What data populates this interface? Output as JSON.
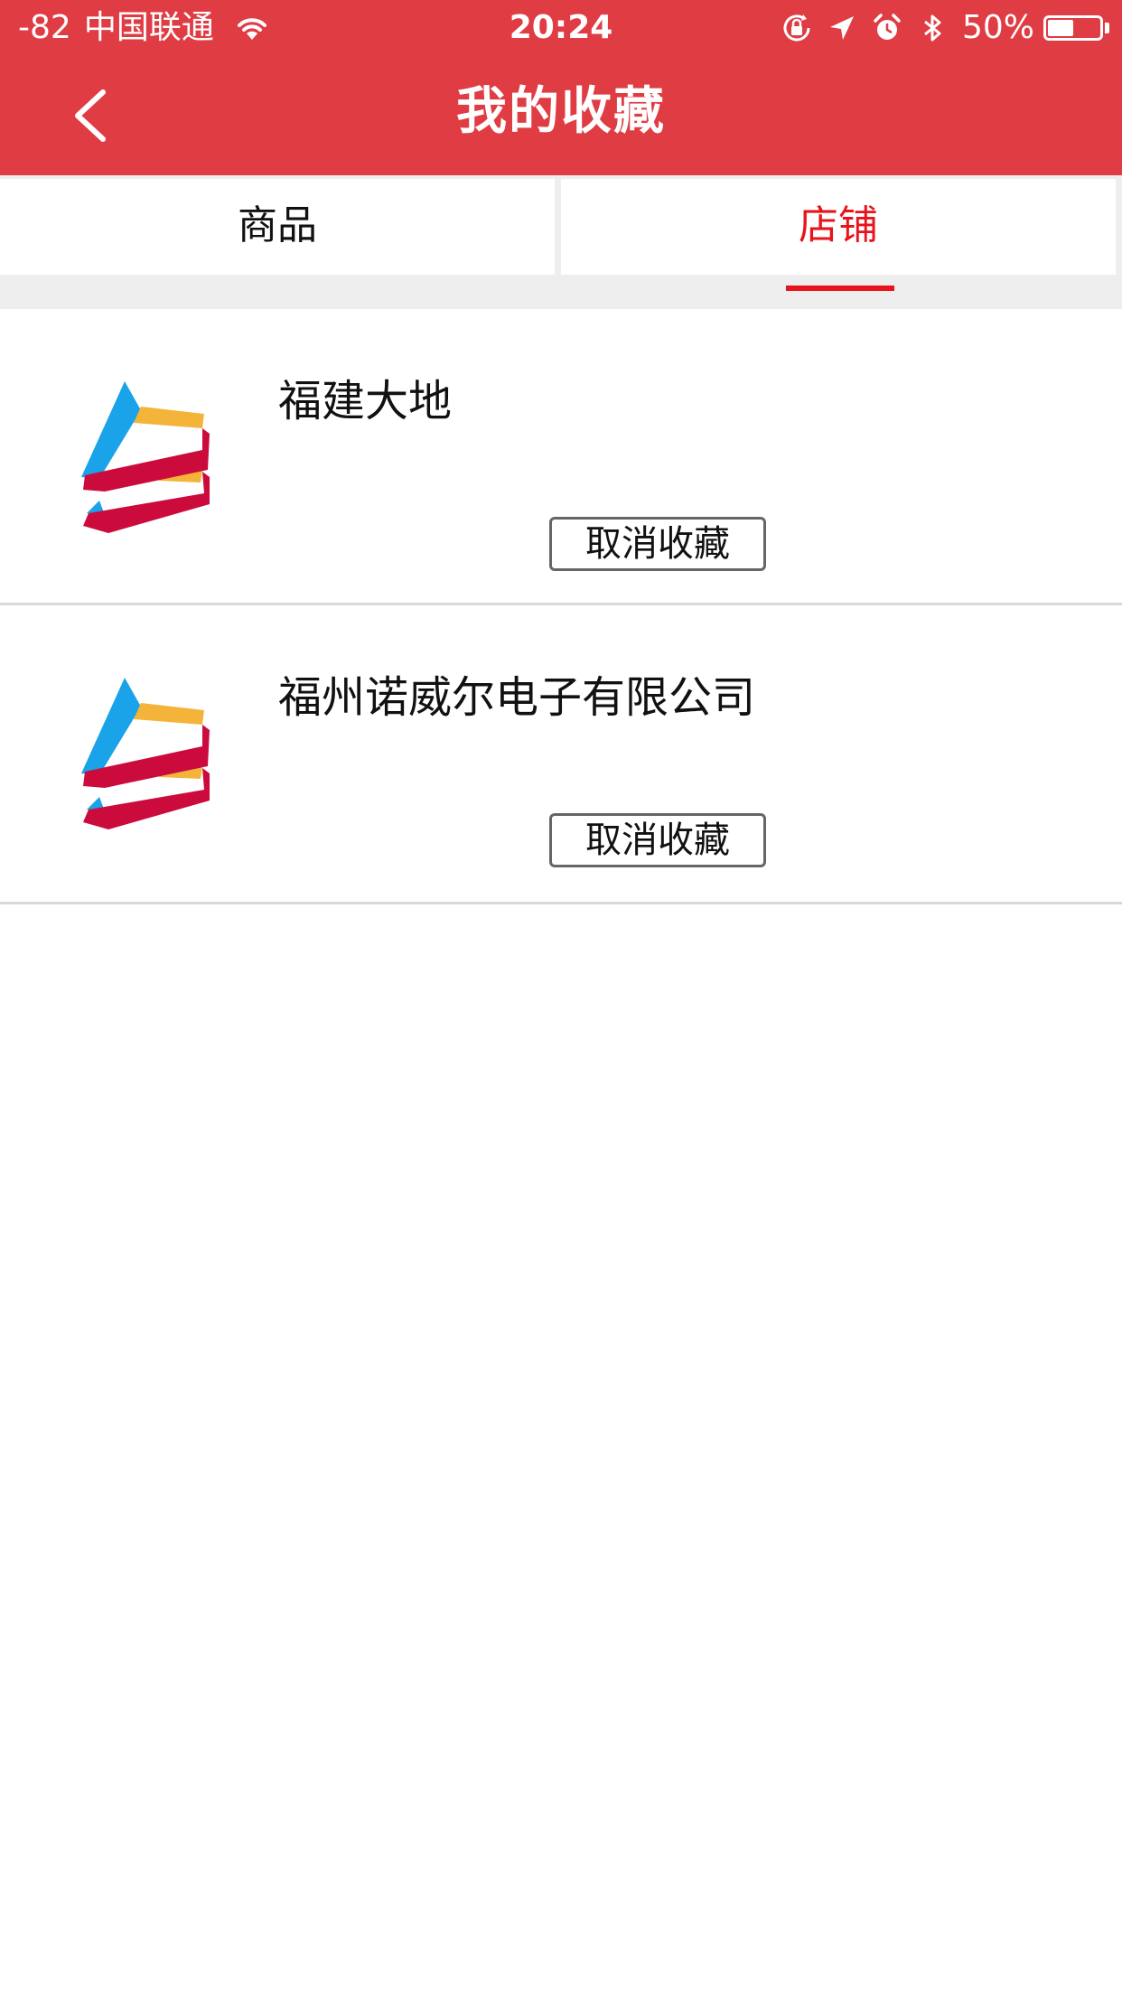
{
  "status_bar": {
    "signal": "-82",
    "carrier": "中国联通",
    "time": "20:24",
    "battery_text": "50%",
    "battery_level": 0.5,
    "icons": [
      "wifi-icon",
      "orientation-lock-icon",
      "location-arrow-icon",
      "alarm-icon",
      "bluetooth-icon",
      "battery-icon"
    ]
  },
  "nav": {
    "title": "我的收藏",
    "back_icon": "chevron-left-icon"
  },
  "tabs": [
    {
      "label": "商品",
      "active": false
    },
    {
      "label": "店铺",
      "active": true
    }
  ],
  "shops": [
    {
      "name": "福建大地",
      "button": "取消收藏",
      "logo_icon": "shop-logo"
    },
    {
      "name": "福州诺威尔电子有限公司",
      "button": "取消收藏",
      "logo_icon": "shop-logo"
    }
  ],
  "colors": {
    "header_bg": "#e03c44",
    "active_tab": "#e8141c",
    "logo_blue": "#1aa3e8",
    "logo_yellow": "#f4b43a",
    "logo_red": "#cc0b3d"
  }
}
